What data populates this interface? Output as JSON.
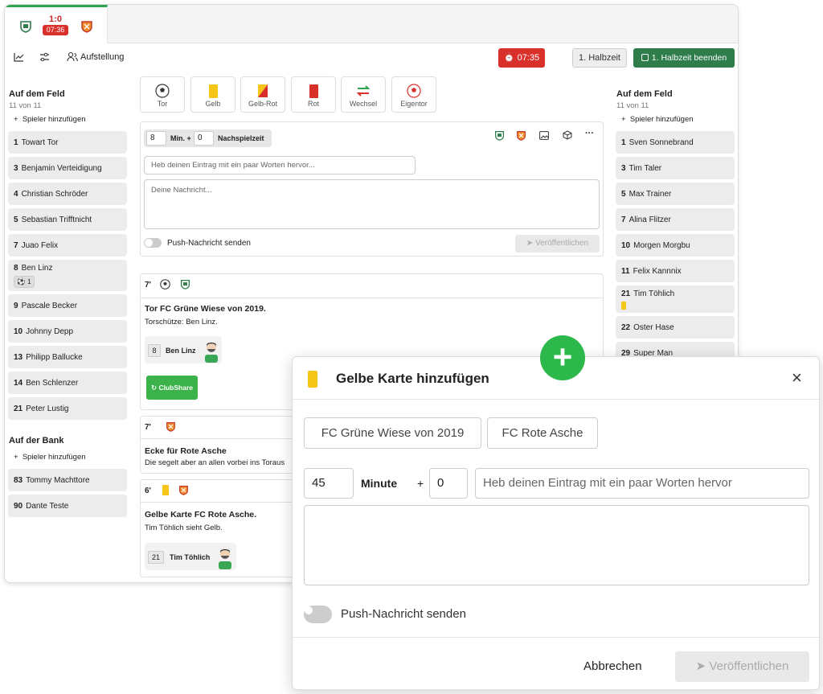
{
  "header": {
    "score": "1:0",
    "match_time": "07:36"
  },
  "toolbar": {
    "lineup_label": "Aufstellung",
    "timer": "07:35",
    "half_label": "1. Halbzeit",
    "end_half_label": "1. Halbzeit beenden"
  },
  "left": {
    "title": "Auf dem Feld",
    "count": "11 von 11",
    "add_label": "Spieler hinzufügen",
    "players": [
      {
        "num": "1",
        "name": "Towart Tor"
      },
      {
        "num": "3",
        "name": "Benjamin Verteidigung"
      },
      {
        "num": "4",
        "name": "Christian Schröder"
      },
      {
        "num": "5",
        "name": "Sebastian Trifftnicht"
      },
      {
        "num": "7",
        "name": "Juao Felix"
      },
      {
        "num": "8",
        "name": "Ben Linz",
        "badge": "1"
      },
      {
        "num": "9",
        "name": "Pascale Becker"
      },
      {
        "num": "10",
        "name": "Johnny Depp"
      },
      {
        "num": "13",
        "name": "Philipp Ballucke"
      },
      {
        "num": "14",
        "name": "Ben Schlenzer"
      },
      {
        "num": "21",
        "name": "Peter Lustig"
      }
    ],
    "bench_title": "Auf der Bank",
    "bench_add_label": "Spieler hinzufügen",
    "bench": [
      {
        "num": "83",
        "name": "Tommy Machttore"
      },
      {
        "num": "90",
        "name": "Dante Teste"
      }
    ]
  },
  "right": {
    "title": "Auf dem Feld",
    "count": "11 von 11",
    "add_label": "Spieler hinzufügen",
    "players": [
      {
        "num": "1",
        "name": "Sven Sonnebrand"
      },
      {
        "num": "3",
        "name": "Tim Taler"
      },
      {
        "num": "5",
        "name": "Max Trainer"
      },
      {
        "num": "7",
        "name": "Alina Flitzer"
      },
      {
        "num": "10",
        "name": "Morgen Morgbu"
      },
      {
        "num": "11",
        "name": "Felix Kannnix"
      },
      {
        "num": "21",
        "name": "Tim Töhlich"
      },
      {
        "num": "22",
        "name": "Oster Hase"
      },
      {
        "num": "29",
        "name": "Super Man"
      }
    ]
  },
  "events_bar": {
    "tor": "Tor",
    "gelb": "Gelb",
    "gelbrot": "Gelb-Rot",
    "rot": "Rot",
    "wechsel": "Wechsel",
    "eigentor": "Eigentor"
  },
  "composer": {
    "minute": "8",
    "min_label": "Min. +",
    "extra": "0",
    "extra_label": "Nachspielzeit",
    "title_placeholder": "Heb deinen Eintrag mit ein paar Worten hervor...",
    "message_placeholder": "Deine Nachricht...",
    "push_label": "Push-Nachricht senden",
    "publish_label": "Veröffentlichen",
    "more": "···"
  },
  "feed": [
    {
      "minute": "7'",
      "title": "Tor FC Grüne Wiese von 2019.",
      "text": "Torschütze: Ben Linz.",
      "player_num": "8",
      "player_name": "Ben Linz",
      "share_label": "ClubShare"
    },
    {
      "minute": "7'",
      "title": "Ecke für Rote Asche",
      "text": "Die segelt aber an allen vorbei ins Toraus"
    },
    {
      "minute": "6'",
      "title": "Gelbe Karte FC Rote Asche.",
      "text": "Tim Töhlich sieht Gelb.",
      "player_num": "21",
      "player_name": "Tim Töhlich"
    }
  ],
  "modal": {
    "title": "Gelbe Karte hinzufügen",
    "close": "×",
    "team_a": "FC Grüne Wiese von 2019",
    "team_b": "FC Rote Asche",
    "minute": "45",
    "minute_label": "Minute",
    "plus": "+",
    "extra": "0",
    "title_placeholder": "Heb deinen Eintrag mit ein paar Worten hervor",
    "push_label": "Push-Nachricht senden",
    "cancel_label": "Abbrechen",
    "publish_label": "Veröffentlichen"
  },
  "colors": {
    "green": "#2e7d4a",
    "red": "#d9302c",
    "yellow": "#f5c518",
    "fab": "#2db84b"
  }
}
